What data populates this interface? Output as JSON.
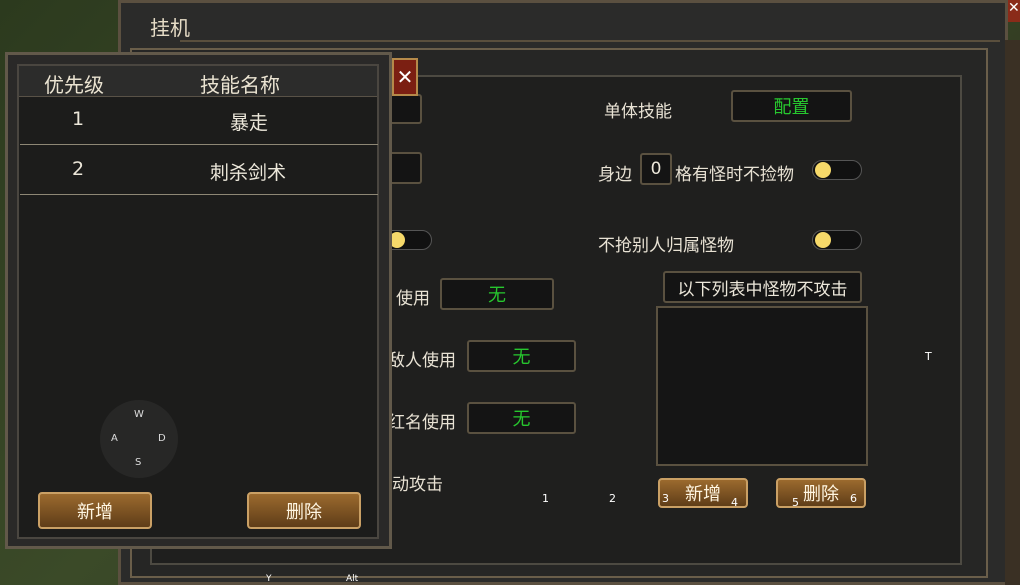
{
  "window": {
    "title": "挂机",
    "close_icon": "close-icon"
  },
  "right_panel": {
    "single_skill_label": "单体技能",
    "single_skill_value": "配置",
    "nearby_prefix": "身边",
    "nearby_count": "0",
    "nearby_suffix": "格有怪时不捡物",
    "no_grab_label": "不抢别人归属怪物",
    "no_attack_label": "以下列表中怪物不攻击",
    "add_button": "新增",
    "delete_button": "删除"
  },
  "left_rows": [
    {
      "label_partial": "使用",
      "value": "无"
    },
    {
      "label_partial": "敌人使用",
      "value": "无"
    },
    {
      "label_partial": "红名使用",
      "value": "无"
    },
    {
      "label_partial": "动攻击"
    }
  ],
  "skill_popup": {
    "columns": [
      "优先级",
      "技能名称"
    ],
    "rows": [
      {
        "priority": "1",
        "skill": "暴走"
      },
      {
        "priority": "2",
        "skill": "刺杀剑术"
      }
    ],
    "add_button": "新增",
    "delete_button": "删除"
  },
  "joystick": {
    "w": "W",
    "a": "A",
    "s": "S",
    "d": "D"
  },
  "hotkeys": [
    "1",
    "2",
    "3",
    "4",
    "5",
    "6",
    "T",
    "Y",
    "Alt"
  ],
  "colors": {
    "accent_green": "#27c72e",
    "toggle_knob": "#f6d96a"
  }
}
